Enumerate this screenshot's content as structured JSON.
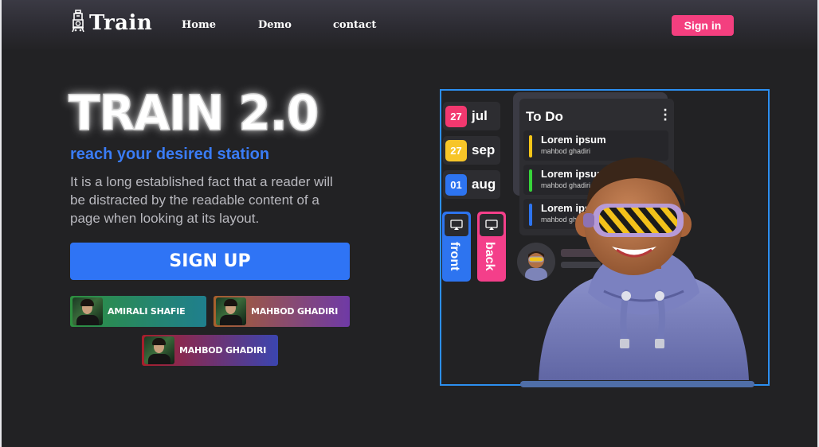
{
  "navbar": {
    "logo_text": "Train",
    "links": [
      {
        "label": "Home"
      },
      {
        "label": "Demo"
      },
      {
        "label": "contact"
      }
    ],
    "signin_label": "Sign in"
  },
  "hero": {
    "title": "TRAIN 2.0",
    "subtitle": "reach your desired station",
    "description": "It is a long established fact that a reader will be distracted by the readable content of a page when looking at its layout.",
    "signup_label": "SIGN UP"
  },
  "people": [
    {
      "name": "AMIRALI SHAFIE"
    },
    {
      "name": "MAHBOD GHADIRI"
    },
    {
      "name": "MAHBOD GHADIRI"
    }
  ],
  "illustration": {
    "dates": [
      {
        "day": "27",
        "month": "jul",
        "color": "#f2386f"
      },
      {
        "day": "27",
        "month": "sep",
        "color": "#f7c528"
      },
      {
        "day": "01",
        "month": "aug",
        "color": "#2d74f0"
      }
    ],
    "flip_cards": [
      {
        "label": "front",
        "color": "#2d74f0"
      },
      {
        "label": "back",
        "color": "#f43f8a"
      }
    ],
    "todo": {
      "title": "To Do",
      "items": [
        {
          "title": "Lorem ipsum",
          "author": "mahbod ghadiri",
          "color": "#f5c518"
        },
        {
          "title": "Lorem ipsum",
          "author": "mahbod ghadiri",
          "color": "#37d33a"
        },
        {
          "title": "Lorem ipsum",
          "author": "mahbod ghadiri",
          "color": "#2d74f0"
        }
      ]
    }
  }
}
